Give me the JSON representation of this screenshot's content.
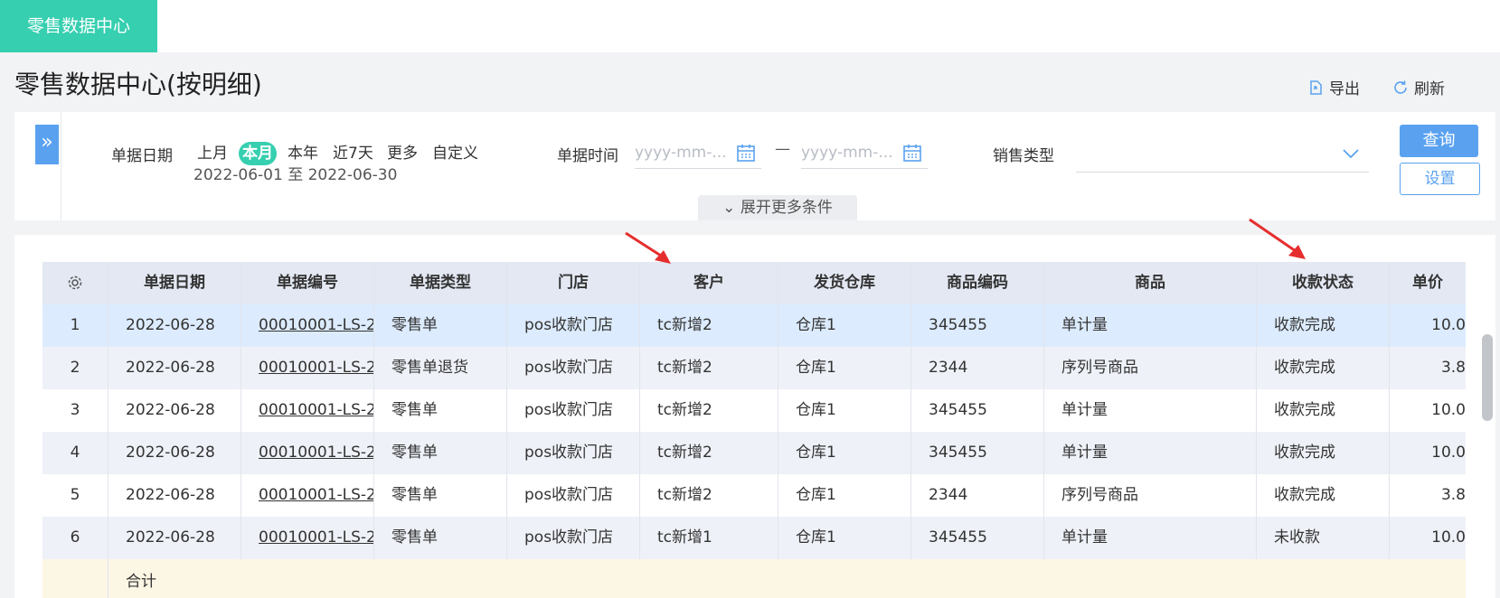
{
  "top_tab": {
    "label": "零售数据中心"
  },
  "header": {
    "title": "零售数据中心(按明细)",
    "export_label": "导出",
    "refresh_label": "刷新"
  },
  "filters": {
    "doc_date_label": "单据日期",
    "date_options": [
      "上月",
      "本月",
      "本年",
      "近7天",
      "更多",
      "自定义"
    ],
    "active_option": "本月",
    "date_range": "2022-06-01 至 2022-06-30",
    "doc_time_label": "单据时间",
    "start_placeholder": "yyyy-mm-...",
    "end_placeholder": "yyyy-mm-...",
    "range_separator": "—",
    "sale_type_label": "销售类型",
    "query_label": "查询",
    "settings_label": "设置",
    "expand_more_label": "展开更多条件"
  },
  "table": {
    "columns": [
      "单据日期",
      "单据编号",
      "单据类型",
      "门店",
      "客户",
      "发货仓库",
      "商品编码",
      "商品",
      "收款状态",
      "单价"
    ],
    "rows": [
      {
        "idx": "1",
        "date": "2022-06-28",
        "doc_no": "00010001-LS-2",
        "doc_type": "零售单",
        "store": "pos收款门店",
        "customer": "tc新增2",
        "warehouse": "仓库1",
        "sku": "345455",
        "product": "单计量",
        "payment_status": "收款完成",
        "price": "10.0"
      },
      {
        "idx": "2",
        "date": "2022-06-28",
        "doc_no": "00010001-LS-2",
        "doc_type": "零售单退货",
        "store": "pos收款门店",
        "customer": "tc新增2",
        "warehouse": "仓库1",
        "sku": "2344",
        "product": "序列号商品",
        "payment_status": "收款完成",
        "price": "3.8"
      },
      {
        "idx": "3",
        "date": "2022-06-28",
        "doc_no": "00010001-LS-2",
        "doc_type": "零售单",
        "store": "pos收款门店",
        "customer": "tc新增2",
        "warehouse": "仓库1",
        "sku": "345455",
        "product": "单计量",
        "payment_status": "收款完成",
        "price": "10.0"
      },
      {
        "idx": "4",
        "date": "2022-06-28",
        "doc_no": "00010001-LS-2",
        "doc_type": "零售单",
        "store": "pos收款门店",
        "customer": "tc新增2",
        "warehouse": "仓库1",
        "sku": "345455",
        "product": "单计量",
        "payment_status": "收款完成",
        "price": "10.0"
      },
      {
        "idx": "5",
        "date": "2022-06-28",
        "doc_no": "00010001-LS-2",
        "doc_type": "零售单",
        "store": "pos收款门店",
        "customer": "tc新增2",
        "warehouse": "仓库1",
        "sku": "2344",
        "product": "序列号商品",
        "payment_status": "收款完成",
        "price": "3.8"
      },
      {
        "idx": "6",
        "date": "2022-06-28",
        "doc_no": "00010001-LS-2",
        "doc_type": "零售单",
        "store": "pos收款门店",
        "customer": "tc新增1",
        "warehouse": "仓库1",
        "sku": "345455",
        "product": "单计量",
        "payment_status": "未收款",
        "price": "10.0"
      }
    ],
    "total_label": "合计"
  },
  "colors": {
    "accent_teal": "#36cfb0",
    "primary_blue": "#5aa2f0",
    "annotation_red": "#e62e2e"
  }
}
